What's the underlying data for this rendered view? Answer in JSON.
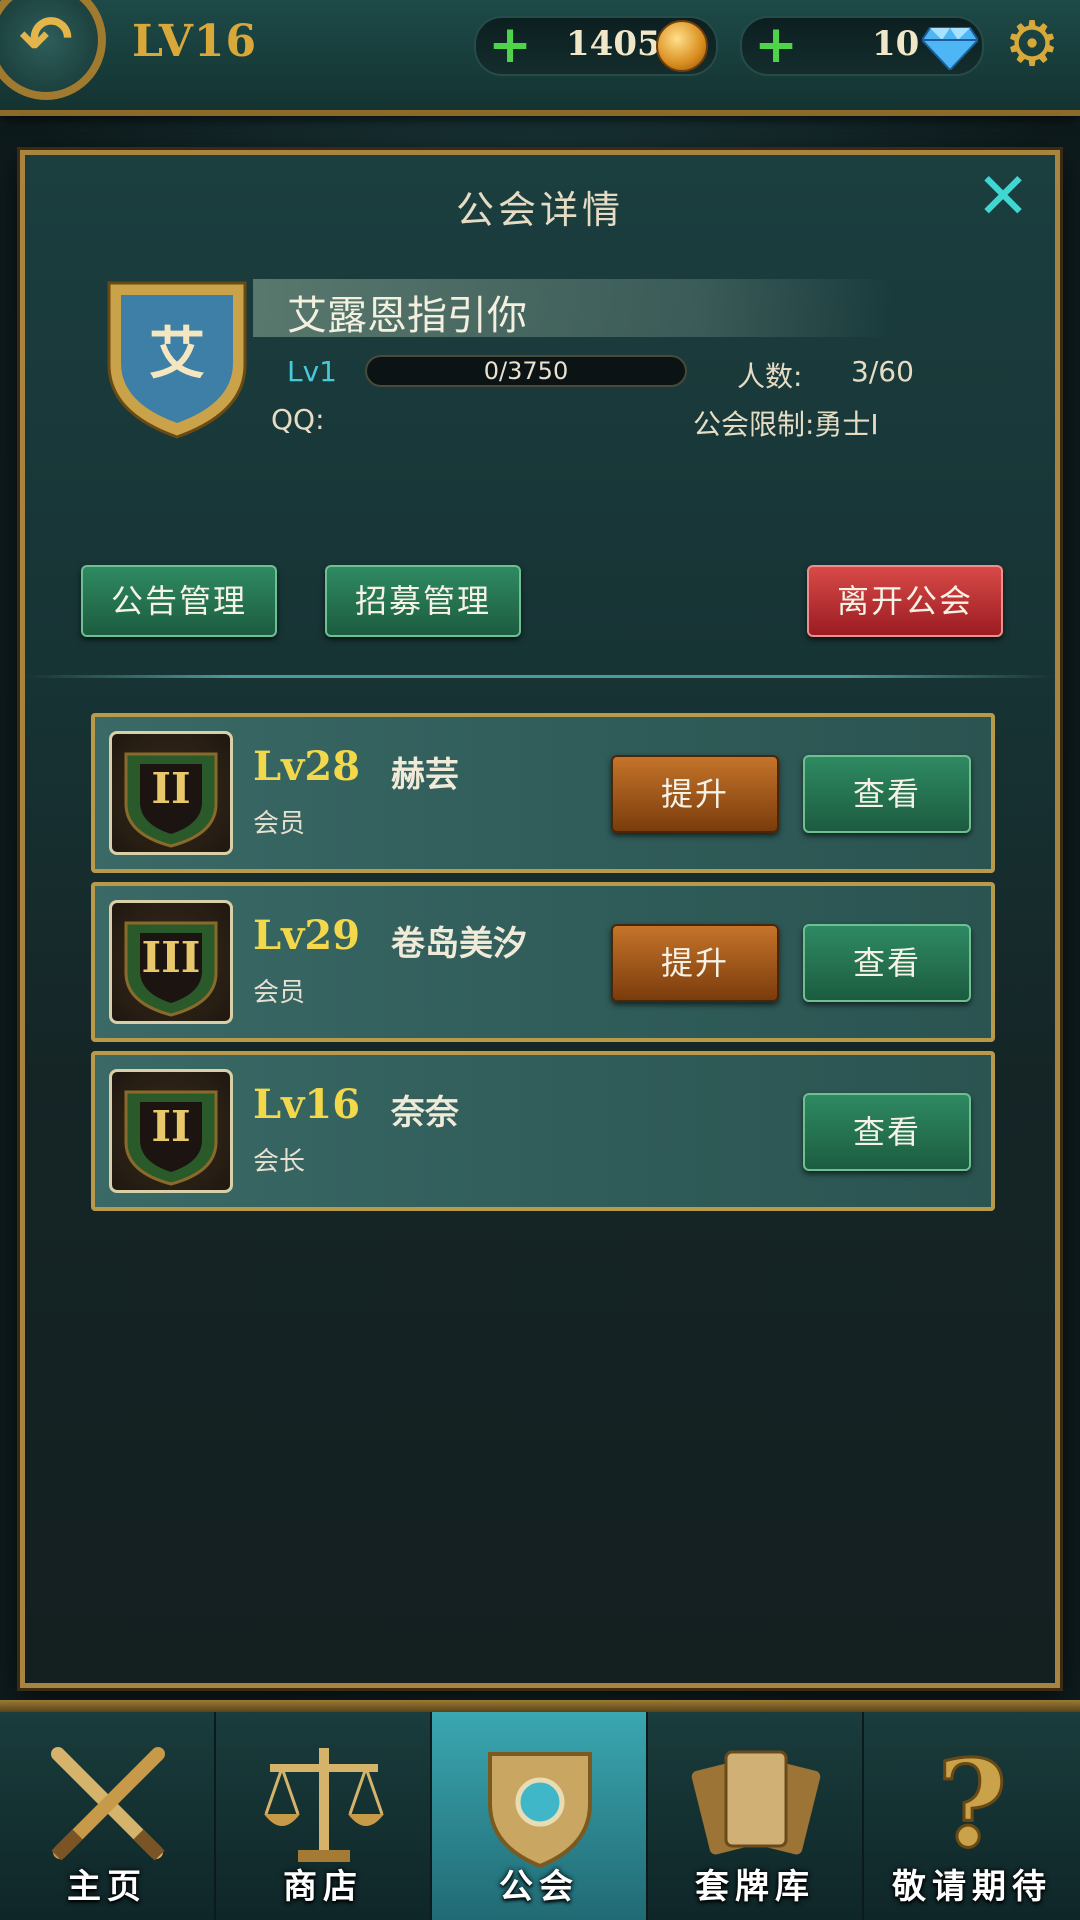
{
  "header": {
    "level": "LV16",
    "gold": "1405",
    "diamonds": "10"
  },
  "panel": {
    "title": "公会详情",
    "guild": {
      "emblem_char": "艾",
      "name": "艾露恩指引你",
      "level": "Lv1",
      "xp": "0/3750",
      "xp_progress": 0,
      "members_label": "人数:",
      "members_value": "3/60",
      "qq_label": "QQ:",
      "limit_label": "公会限制:勇士Ⅰ"
    },
    "buttons": {
      "announce": "公告管理",
      "recruit": "招募管理",
      "leave": "离开公会"
    },
    "members": [
      {
        "rank": "II",
        "level": "Lv28",
        "name": "赫芸",
        "role": "会员",
        "promote": "提升",
        "view": "查看"
      },
      {
        "rank": "III",
        "level": "Lv29",
        "name": "卷岛美汐",
        "role": "会员",
        "promote": "提升",
        "view": "查看"
      },
      {
        "rank": "II",
        "level": "Lv16",
        "name": "奈奈",
        "role": "会长",
        "view": "查看"
      }
    ]
  },
  "nav": [
    {
      "label": "主页",
      "icon": "crossed-swords-icon"
    },
    {
      "label": "商店",
      "icon": "scales-icon"
    },
    {
      "label": "公会",
      "icon": "guild-emblem-icon",
      "active": true
    },
    {
      "label": "套牌库",
      "icon": "card-deck-icon"
    },
    {
      "label": "敬请期待",
      "icon": "question-mark-icon"
    }
  ],
  "colors": {
    "accent_gold": "#d9a83a",
    "green_button": "#2e8a62",
    "red_button": "#c23a3a",
    "orange_button": "#b0621f",
    "cyan_close": "#3ed7d1"
  }
}
